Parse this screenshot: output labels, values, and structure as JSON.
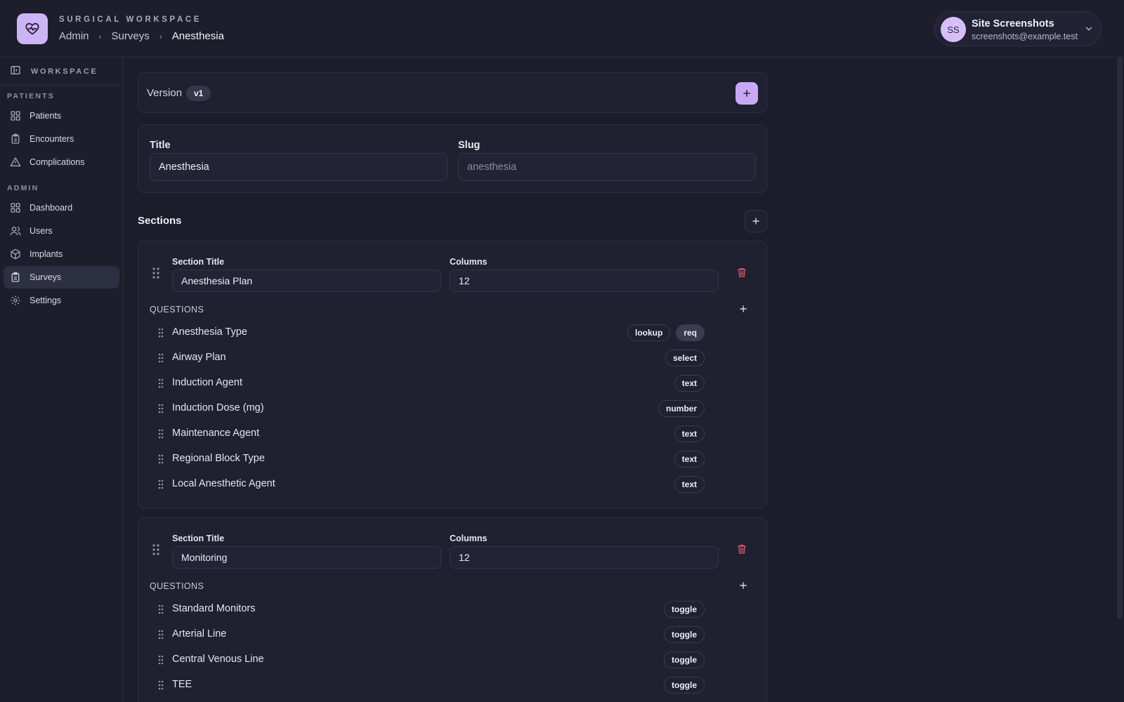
{
  "header": {
    "workspace_label": "SURGICAL WORKSPACE",
    "breadcrumb": [
      "Admin",
      "Surveys",
      "Anesthesia"
    ],
    "user": {
      "initials": "SS",
      "name": "Site Screenshots",
      "email": "screenshots@example.test"
    }
  },
  "sidebar": {
    "top_label": "WORKSPACE",
    "groups": [
      {
        "label": "PATIENTS",
        "items": [
          {
            "label": "Patients",
            "icon": "grid-icon"
          },
          {
            "label": "Encounters",
            "icon": "clipboard-icon"
          },
          {
            "label": "Complications",
            "icon": "warning-icon"
          }
        ]
      },
      {
        "label": "ADMIN",
        "items": [
          {
            "label": "Dashboard",
            "icon": "grid-icon"
          },
          {
            "label": "Users",
            "icon": "users-icon"
          },
          {
            "label": "Implants",
            "icon": "box-icon"
          },
          {
            "label": "Surveys",
            "icon": "clipboard-icon",
            "active": true
          },
          {
            "label": "Settings",
            "icon": "gear-icon"
          }
        ]
      }
    ]
  },
  "main": {
    "version": {
      "label": "Version",
      "value": "v1"
    },
    "title_field": {
      "label": "Title",
      "value": "Anesthesia"
    },
    "slug_field": {
      "label": "Slug",
      "placeholder": "anesthesia"
    },
    "sections_label": "Sections",
    "sections": [
      {
        "title_label": "Section Title",
        "title_value": "Anesthesia Plan",
        "columns_label": "Columns",
        "columns_value": "12",
        "questions_label": "QUESTIONS",
        "questions": [
          {
            "name": "Anesthesia Type",
            "tags": [
              "lookup",
              "req"
            ]
          },
          {
            "name": "Airway Plan",
            "tags": [
              "select"
            ]
          },
          {
            "name": "Induction Agent",
            "tags": [
              "text"
            ]
          },
          {
            "name": "Induction Dose (mg)",
            "tags": [
              "number"
            ]
          },
          {
            "name": "Maintenance Agent",
            "tags": [
              "text"
            ]
          },
          {
            "name": "Regional Block Type",
            "tags": [
              "text"
            ]
          },
          {
            "name": "Local Anesthetic Agent",
            "tags": [
              "text"
            ]
          }
        ]
      },
      {
        "title_label": "Section Title",
        "title_value": "Monitoring",
        "columns_label": "Columns",
        "columns_value": "12",
        "questions_label": "QUESTIONS",
        "questions": [
          {
            "name": "Standard Monitors",
            "tags": [
              "toggle"
            ]
          },
          {
            "name": "Arterial Line",
            "tags": [
              "toggle"
            ]
          },
          {
            "name": "Central Venous Line",
            "tags": [
              "toggle"
            ]
          },
          {
            "name": "TEE",
            "tags": [
              "toggle"
            ]
          }
        ]
      }
    ]
  },
  "colors": {
    "accent": "#c9a9f6",
    "danger": "#e0576a",
    "background": "#1c1d2b"
  }
}
